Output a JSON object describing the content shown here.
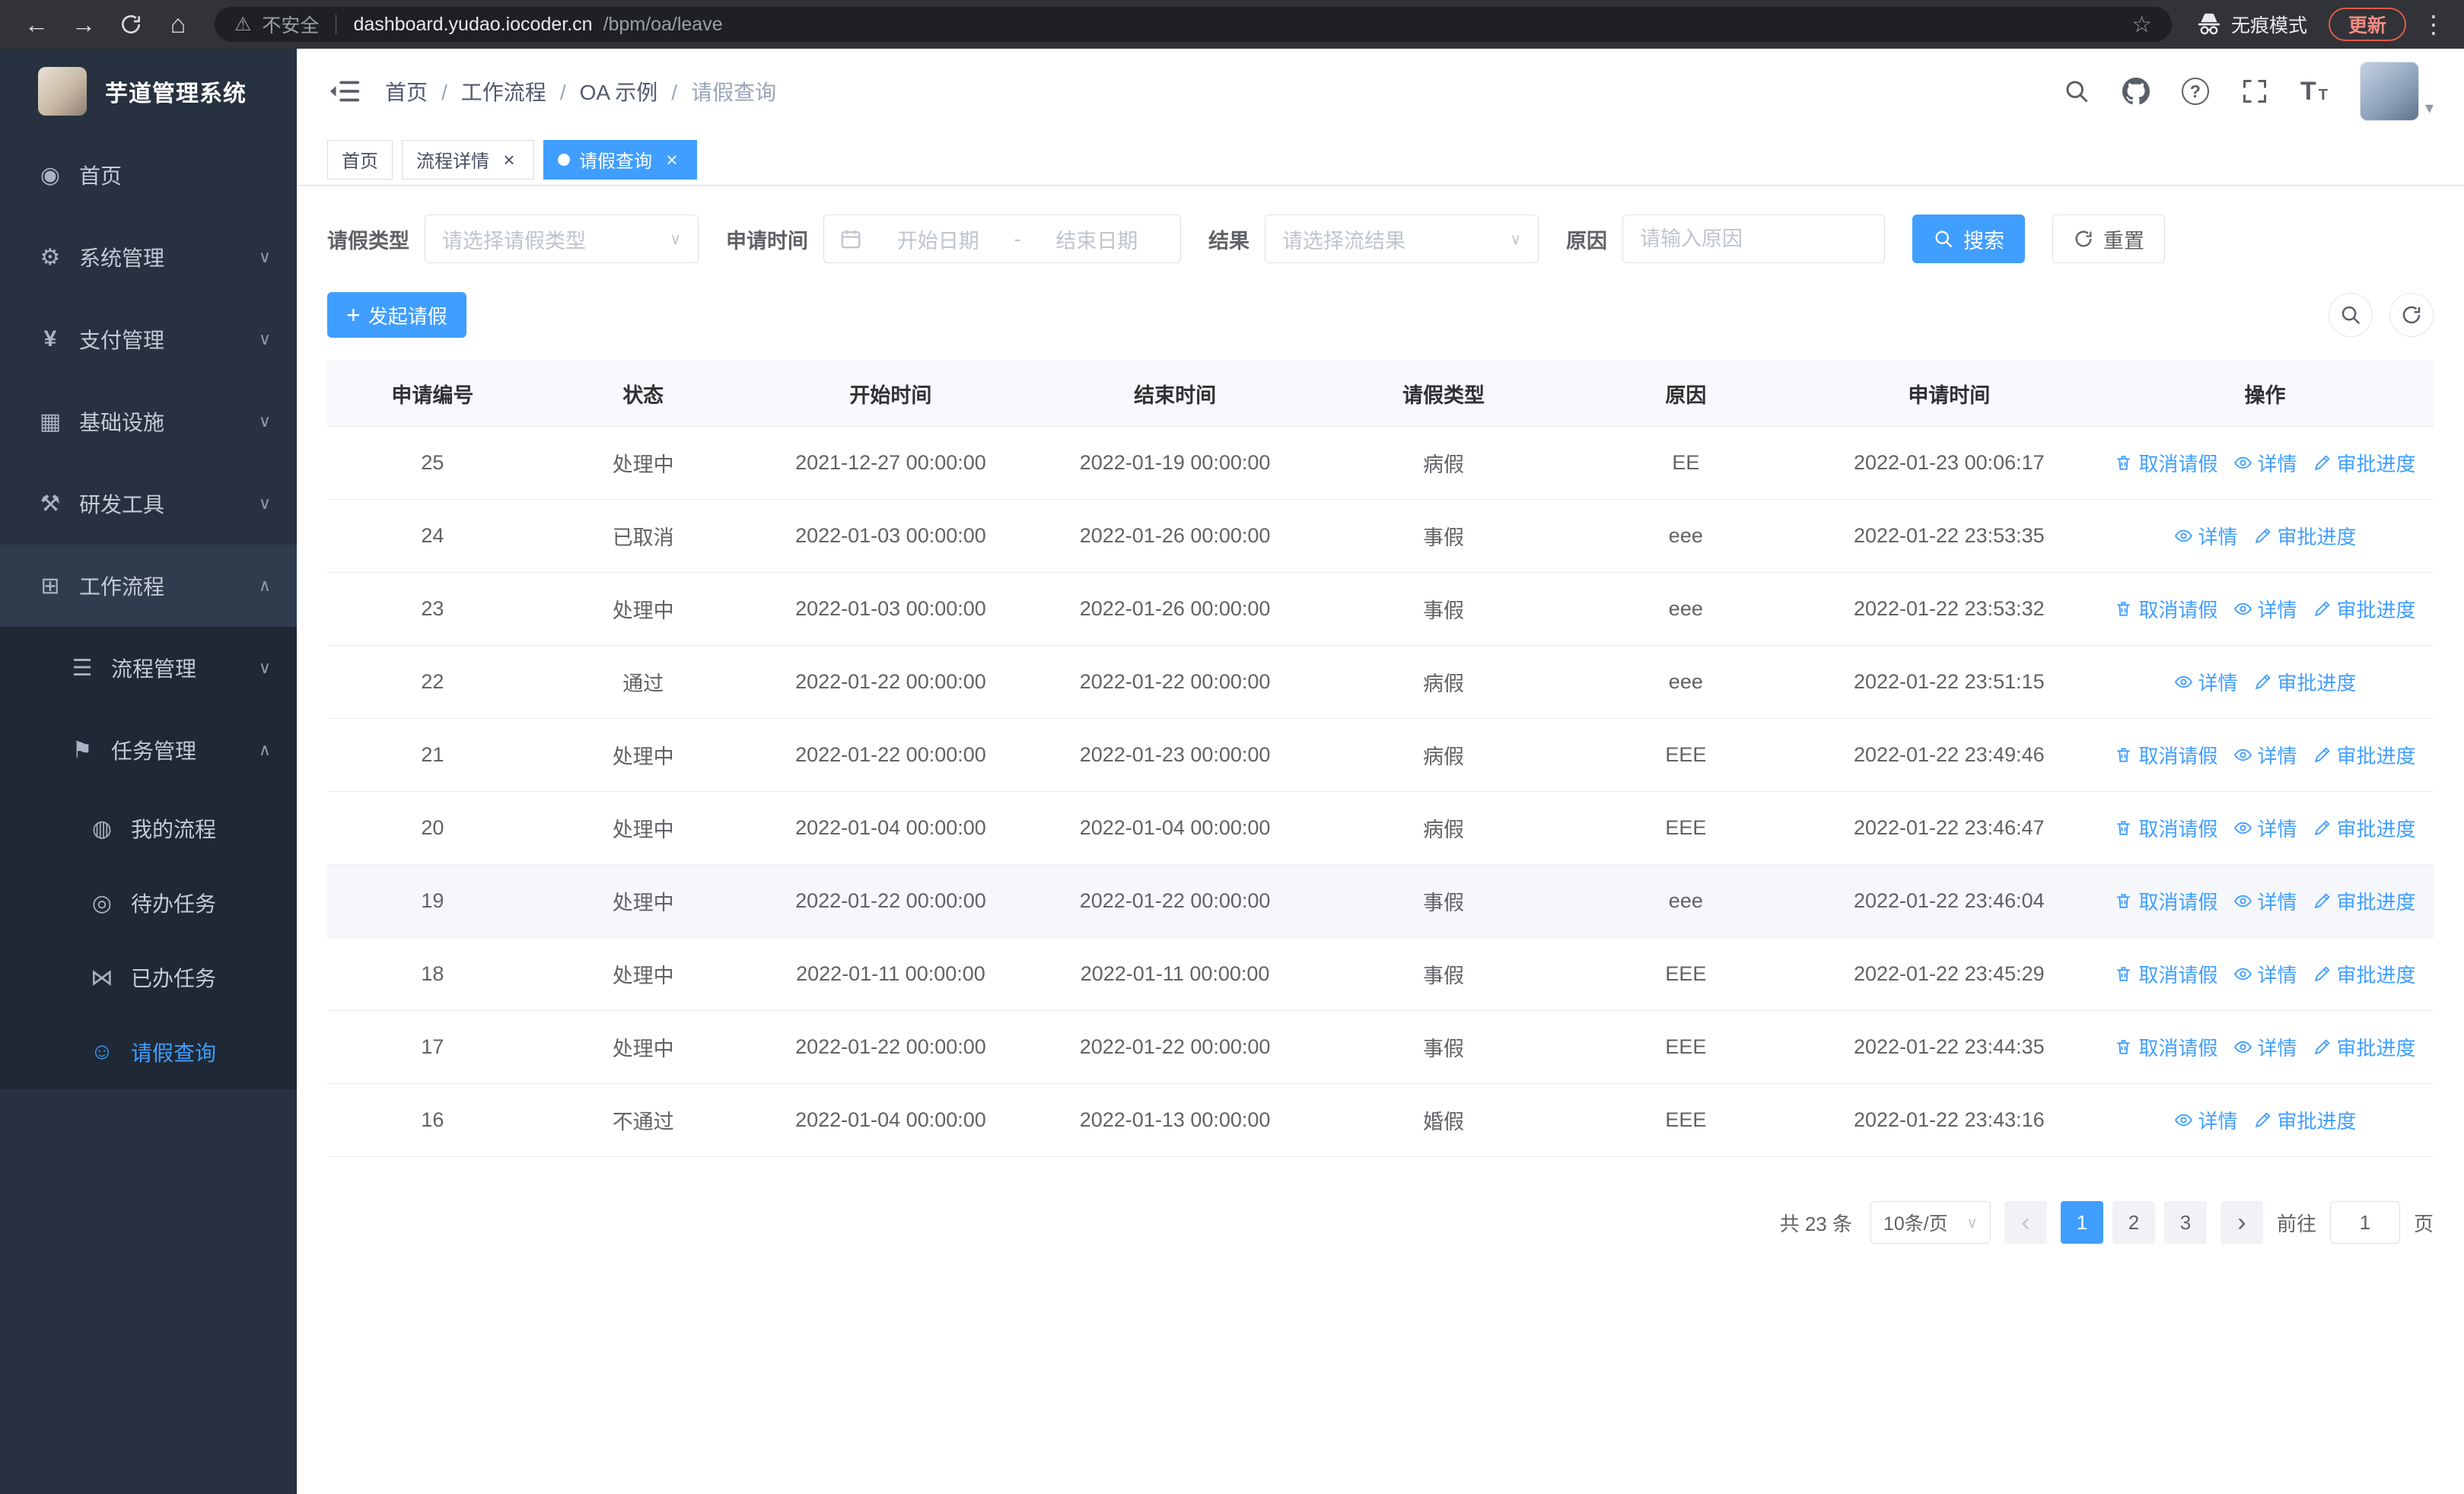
{
  "colors": {
    "accent": "#409eff",
    "sidebar_bg": "#27313f",
    "submenu_bg": "#1f2835",
    "table_header_bg": "#f7f8fc",
    "update_pill": "#f28b82"
  },
  "browser": {
    "security_label": "不安全",
    "url_host": "dashboard.yudao.iocoder.cn",
    "url_path": "/bpm/oa/leave",
    "incognito_label": "无痕模式",
    "update_label": "更新"
  },
  "sidebar": {
    "logo_title": "芋道管理系统",
    "menu": [
      {
        "label": "首页",
        "icon": "dashboard-icon",
        "level": "1"
      },
      {
        "label": "系统管理",
        "icon": "gear-icon",
        "level": "1",
        "chevron": "down"
      },
      {
        "label": "支付管理",
        "icon": "payment-icon",
        "level": "1",
        "chevron": "down"
      },
      {
        "label": "基础设施",
        "icon": "infrastructure-icon",
        "level": "1",
        "chevron": "down"
      },
      {
        "label": "研发工具",
        "icon": "devtools-icon",
        "level": "1",
        "chevron": "down"
      },
      {
        "label": "工作流程",
        "icon": "workflow-icon",
        "level": "1",
        "chevron": "up",
        "open": true
      },
      {
        "label": "流程管理",
        "icon": "process-icon",
        "level": "2",
        "chevron": "down",
        "sub": true
      },
      {
        "label": "任务管理",
        "icon": "task-icon",
        "level": "2",
        "chevron": "up",
        "sub": true
      },
      {
        "label": "我的流程",
        "icon": "chat-icon",
        "level": "3",
        "sub": true
      },
      {
        "label": "待办任务",
        "icon": "eye-icon",
        "level": "3",
        "sub": true
      },
      {
        "label": "已办任务",
        "icon": "scissors-icon",
        "level": "3",
        "sub": true
      },
      {
        "label": "请假查询",
        "icon": "user-icon",
        "level": "3",
        "sub": true,
        "active": true
      }
    ]
  },
  "navbar": {
    "breadcrumb": [
      {
        "label": "首页"
      },
      {
        "label": "工作流程"
      },
      {
        "label": "OA 示例"
      },
      {
        "label": "请假查询",
        "current": true
      }
    ]
  },
  "tabs": [
    {
      "label": "首页"
    },
    {
      "label": "流程详情",
      "closable": true
    },
    {
      "label": "请假查询",
      "closable": true,
      "active": true
    }
  ],
  "filters": {
    "leave_type_label": "请假类型",
    "leave_type_placeholder": "请选择请假类型",
    "apply_time_label": "申请时间",
    "start_placeholder": "开始日期",
    "range_separator": "-",
    "end_placeholder": "结束日期",
    "result_label": "结果",
    "result_placeholder": "请选择流结果",
    "reason_label": "原因",
    "reason_placeholder": "请输入原因",
    "search_label": "搜索",
    "reset_label": "重置"
  },
  "toolbar": {
    "create_label": "发起请假"
  },
  "table": {
    "headers": [
      {
        "label": "申请编号",
        "key": "id"
      },
      {
        "label": "状态",
        "key": "status"
      },
      {
        "label": "开始时间",
        "key": "start"
      },
      {
        "label": "结束时间",
        "key": "end"
      },
      {
        "label": "请假类型",
        "key": "type"
      },
      {
        "label": "原因",
        "key": "reason"
      },
      {
        "label": "申请时间",
        "key": "apply_time"
      },
      {
        "label": "操作",
        "key": "actions"
      }
    ],
    "actions": {
      "cancel": "取消请假",
      "detail": "详情",
      "progress": "审批进度"
    },
    "rows": [
      {
        "id": "25",
        "status": "处理中",
        "start": "2021-12-27 00:00:00",
        "end": "2022-01-19 00:00:00",
        "type": "病假",
        "reason": "EE",
        "apply_time": "2022-01-23 00:06:17",
        "cancelable": true
      },
      {
        "id": "24",
        "status": "已取消",
        "start": "2022-01-03 00:00:00",
        "end": "2022-01-26 00:00:00",
        "type": "事假",
        "reason": "eee",
        "apply_time": "2022-01-22 23:53:35"
      },
      {
        "id": "23",
        "status": "处理中",
        "start": "2022-01-03 00:00:00",
        "end": "2022-01-26 00:00:00",
        "type": "事假",
        "reason": "eee",
        "apply_time": "2022-01-22 23:53:32",
        "cancelable": true
      },
      {
        "id": "22",
        "status": "通过",
        "start": "2022-01-22 00:00:00",
        "end": "2022-01-22 00:00:00",
        "type": "病假",
        "reason": "eee",
        "apply_time": "2022-01-22 23:51:15"
      },
      {
        "id": "21",
        "status": "处理中",
        "start": "2022-01-22 00:00:00",
        "end": "2022-01-23 00:00:00",
        "type": "病假",
        "reason": "EEE",
        "apply_time": "2022-01-22 23:49:46",
        "cancelable": true
      },
      {
        "id": "20",
        "status": "处理中",
        "start": "2022-01-04 00:00:00",
        "end": "2022-01-04 00:00:00",
        "type": "病假",
        "reason": "EEE",
        "apply_time": "2022-01-22 23:46:47",
        "cancelable": true
      },
      {
        "id": "19",
        "status": "处理中",
        "start": "2022-01-22 00:00:00",
        "end": "2022-01-22 00:00:00",
        "type": "事假",
        "reason": "eee",
        "apply_time": "2022-01-22 23:46:04",
        "cancelable": true,
        "highlighted": true
      },
      {
        "id": "18",
        "status": "处理中",
        "start": "2022-01-11 00:00:00",
        "end": "2022-01-11 00:00:00",
        "type": "事假",
        "reason": "EEE",
        "apply_time": "2022-01-22 23:45:29",
        "cancelable": true
      },
      {
        "id": "17",
        "status": "处理中",
        "start": "2022-01-22 00:00:00",
        "end": "2022-01-22 00:00:00",
        "type": "事假",
        "reason": "EEE",
        "apply_time": "2022-01-22 23:44:35",
        "cancelable": true
      },
      {
        "id": "16",
        "status": "不通过",
        "start": "2022-01-04 00:00:00",
        "end": "2022-01-13 00:00:00",
        "type": "婚假",
        "reason": "EEE",
        "apply_time": "2022-01-22 23:43:16"
      }
    ]
  },
  "pagination": {
    "total": "共 23 条",
    "page_size": "10条/页",
    "pages": [
      {
        "num": "1",
        "active": true
      },
      {
        "num": "2"
      },
      {
        "num": "3"
      }
    ],
    "goto_label": "前往",
    "goto_value": "1",
    "page_unit": "页"
  }
}
